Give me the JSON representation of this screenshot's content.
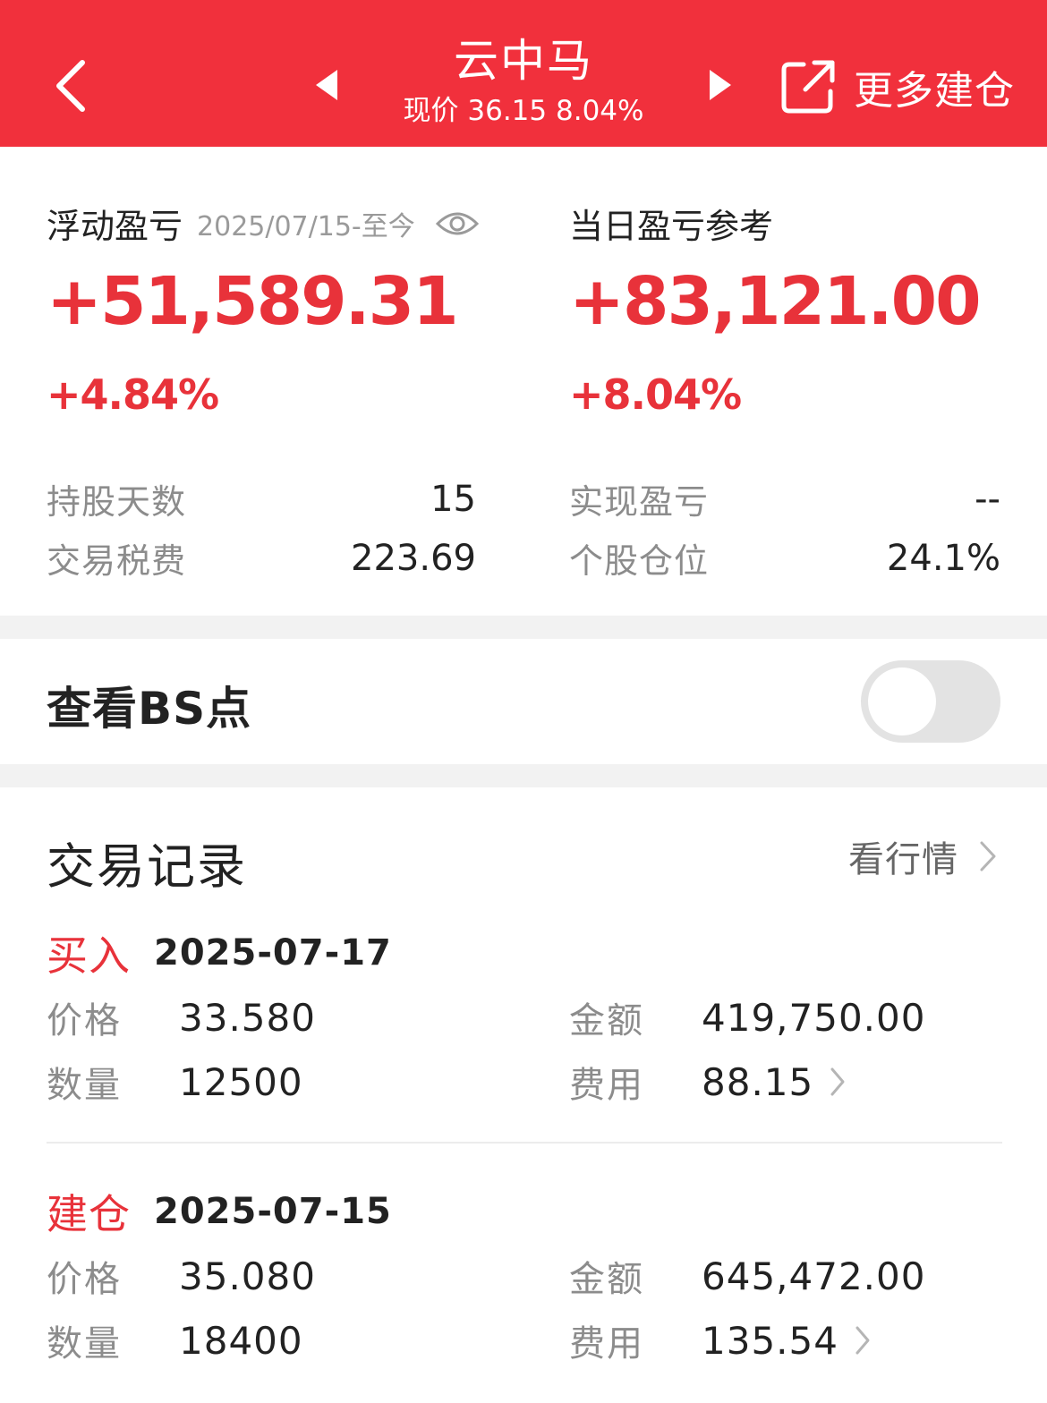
{
  "header": {
    "title": "云中马",
    "subtitle": "现价 36.15 8.04%",
    "more_label": "更多建仓"
  },
  "summary": {
    "floating": {
      "label": "浮动盈亏",
      "date_range": "2025/07/15-至今",
      "value": "+51,589.31",
      "pct": "+4.84%"
    },
    "daily": {
      "label": "当日盈亏参考",
      "value": "+83,121.00",
      "pct": "+8.04%"
    },
    "stats_left": [
      {
        "label": "持股天数",
        "value": "15"
      },
      {
        "label": "交易税费",
        "value": "223.69"
      }
    ],
    "stats_right": [
      {
        "label": "实现盈亏",
        "value": "--"
      },
      {
        "label": "个股仓位",
        "value": "24.1%"
      }
    ]
  },
  "bs": {
    "label": "查看BS点",
    "enabled": false
  },
  "records": {
    "title": "交易记录",
    "quote_link": "看行情",
    "items": [
      {
        "type": "买入",
        "date": "2025-07-17",
        "price_label": "价格",
        "price": "33.580",
        "amount_label": "金额",
        "amount": "419,750.00",
        "qty_label": "数量",
        "qty": "12500",
        "fee_label": "费用",
        "fee": "88.15"
      },
      {
        "type": "建仓",
        "date": "2025-07-15",
        "price_label": "价格",
        "price": "35.080",
        "amount_label": "金额",
        "amount": "645,472.00",
        "qty_label": "数量",
        "qty": "18400",
        "fee_label": "费用",
        "fee": "135.54"
      }
    ]
  },
  "colors": {
    "header_bg": "#f1303c",
    "up_red": "#e8323a",
    "label_gray": "#8c8c8c"
  }
}
